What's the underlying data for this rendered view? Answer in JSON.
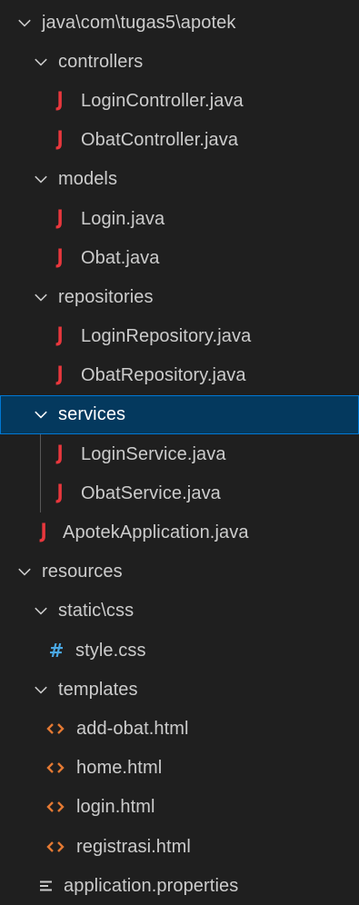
{
  "explorer": {
    "items": [
      {
        "label": "java\\com\\tugas5\\apotek",
        "kind": "folder",
        "expanded": true,
        "depth": 0
      },
      {
        "label": "controllers",
        "kind": "folder",
        "expanded": true,
        "depth": 1
      },
      {
        "label": "LoginController.java",
        "kind": "java",
        "depth": 2
      },
      {
        "label": "ObatController.java",
        "kind": "java",
        "depth": 2
      },
      {
        "label": "models",
        "kind": "folder",
        "expanded": true,
        "depth": 1
      },
      {
        "label": "Login.java",
        "kind": "java",
        "depth": 2
      },
      {
        "label": "Obat.java",
        "kind": "java",
        "depth": 2
      },
      {
        "label": "repositories",
        "kind": "folder",
        "expanded": true,
        "depth": 1
      },
      {
        "label": "LoginRepository.java",
        "kind": "java",
        "depth": 2
      },
      {
        "label": "ObatRepository.java",
        "kind": "java",
        "depth": 2
      },
      {
        "label": "services",
        "kind": "folder",
        "expanded": true,
        "depth": 1,
        "selected": true
      },
      {
        "label": "LoginService.java",
        "kind": "java",
        "depth": 2
      },
      {
        "label": "ObatService.java",
        "kind": "java",
        "depth": 2
      },
      {
        "label": "ApotekApplication.java",
        "kind": "java",
        "depth": 1
      },
      {
        "label": "resources",
        "kind": "folder",
        "expanded": true,
        "depth": 0
      },
      {
        "label": "static\\css",
        "kind": "folder",
        "expanded": true,
        "depth": 1
      },
      {
        "label": "style.css",
        "kind": "css",
        "depth": 2
      },
      {
        "label": "templates",
        "kind": "folder",
        "expanded": true,
        "depth": 1
      },
      {
        "label": "add-obat.html",
        "kind": "html",
        "depth": 2
      },
      {
        "label": "home.html",
        "kind": "html",
        "depth": 2
      },
      {
        "label": "login.html",
        "kind": "html",
        "depth": 2
      },
      {
        "label": "registrasi.html",
        "kind": "html",
        "depth": 2
      },
      {
        "label": "application.properties",
        "kind": "properties",
        "depth": 1
      }
    ]
  },
  "icons": {
    "folder": "chevron-down-icon",
    "java": "java-file-icon",
    "css": "css-file-icon",
    "html": "html-file-icon",
    "properties": "properties-file-icon"
  },
  "colors": {
    "background": "#1f1f1f",
    "text": "#cccccc",
    "selected_background": "#04395e",
    "selected_border": "#0078d4",
    "java_icon": "#e8373d",
    "css_icon": "#4aa8e4",
    "html_icon": "#e37933",
    "indent_guide": "#585858"
  }
}
